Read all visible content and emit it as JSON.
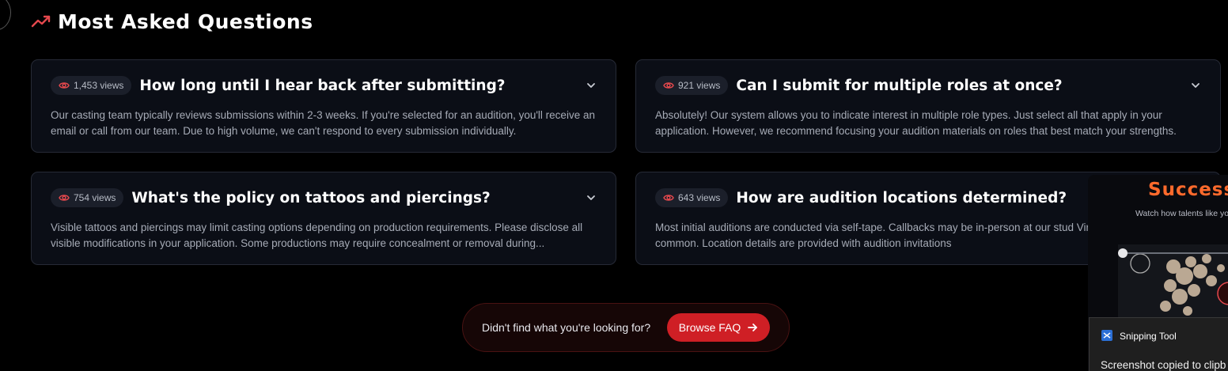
{
  "section": {
    "title": "Most Asked Questions",
    "icon": "trending-up-icon"
  },
  "faqs": [
    {
      "views": "1,453 views",
      "question": "How long until I hear back after submitting?",
      "answer": "Our casting team typically reviews submissions within 2-3 weeks. If you're selected for an audition, you'll receive an email or call from our team. Due to high volume, we can't respond to every submission individually."
    },
    {
      "views": "921 views",
      "question": "Can I submit for multiple roles at once?",
      "answer": "Absolutely! Our system allows you to indicate interest in multiple role types. Just select all that apply in your application. However, we recommend focusing your audition materials on roles that best match your strengths."
    },
    {
      "views": "754 views",
      "question": "What's the policy on tattoos and piercings?",
      "answer": "Visible tattoos and piercings may limit casting options depending on production requirements. Please disclose all visible modifications in your application. Some productions may require concealment or removal during..."
    },
    {
      "views": "643 views",
      "question": "How are audition locations determined?",
      "answer": "Most initial auditions are conducted via self-tape. Callbacks may be in-person at our stud Virtual callbacks are also common. Location details are provided with audition invitations"
    }
  ],
  "cta": {
    "text": "Didn't find what you're looking for?",
    "button": "Browse FAQ"
  },
  "success_panel": {
    "title": "Success",
    "subtitle": "Watch how talents like you"
  },
  "toast": {
    "app": "Snipping Tool",
    "message": "Screenshot copied to clipb"
  },
  "colors": {
    "accent": "#cf1f25",
    "accent_icon": "#e5484d",
    "card_bg": "#0b0e16",
    "success_orange": "#ff6a2c"
  }
}
